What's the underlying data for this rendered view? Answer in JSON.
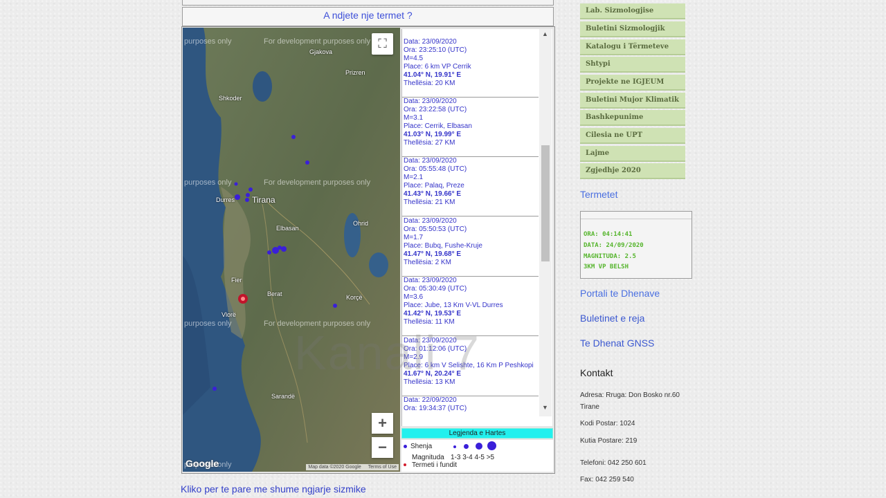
{
  "header": {
    "question": "A ndjete nje termet ?"
  },
  "map": {
    "watermark": "For development purposes only",
    "watermark_short": "purposes only",
    "cities": [
      "Shkoder",
      "Durres",
      "Tirana",
      "Elbasan",
      "Fier",
      "Berat",
      "Vlorë",
      "Korçë",
      "Ohrid",
      "Prizren",
      "Gjakova",
      "Sarandë"
    ],
    "google": "Google",
    "map_data": "Map data ©2020 Google",
    "terms": "Terms of Use",
    "fullscreen_icon": "⛶",
    "zoom_in": "+",
    "zoom_out": "−"
  },
  "quakes": [
    {
      "data": "Data: 23/09/2020",
      "ora": "Ora: 23:25:10 (UTC)",
      "m": "M=4.5",
      "place": "Place: 6 km VP Cerrik",
      "coord": "41.04° N, 19.91° E",
      "depth": "Thellësia: 20 KM"
    },
    {
      "data": "Data: 23/09/2020",
      "ora": "Ora: 23:22:58 (UTC)",
      "m": "M=3.1",
      "place": "Place: Cerrik, Elbasan",
      "coord": "41.03° N, 19.99° E",
      "depth": "Thellësia: 27 KM"
    },
    {
      "data": "Data: 23/09/2020",
      "ora": "Ora: 05:55:48 (UTC)",
      "m": "M=2.1",
      "place": "Place: Palaq, Preze",
      "coord": "41.43° N, 19.66° E",
      "depth": "Thellësia: 21 KM"
    },
    {
      "data": "Data: 23/09/2020",
      "ora": "Ora: 05:50:53 (UTC)",
      "m": "M=1.7",
      "place": "Place: Bubq, Fushe-Kruje",
      "coord": "41.47° N, 19.68° E",
      "depth": "Thellësia: 2 KM"
    },
    {
      "data": "Data: 23/09/2020",
      "ora": "Ora: 05:30:49 (UTC)",
      "m": "M=3.6",
      "place": "Place: Jube, 13 Km V-VL Durres",
      "coord": "41.42° N, 19.53° E",
      "depth": "Thellësia: 11 KM"
    },
    {
      "data": "Data: 23/09/2020",
      "ora": "Ora: 01:12:06 (UTC)",
      "m": "M=2.9",
      "place": "Place: 6 km V Selishte, 16 Km P Peshkopi",
      "coord": "41.67° N, 20.24° E",
      "depth": "Thellësia: 13 KM"
    },
    {
      "data": "Data: 22/09/2020",
      "ora": "Ora: 19:34:37 (UTC)",
      "m": "",
      "place": "",
      "coord": "",
      "depth": ""
    }
  ],
  "legend": {
    "title": "Legjenda e Hartes",
    "shenja": "Shenja",
    "magnituda": "Magnituda",
    "ranges": "1-3 3-4 4-5 >5",
    "last": "Termeti i fundit"
  },
  "more_link": "Kliko per te pare me shume ngjarje sizmike",
  "menu": [
    "Lab. Sizmologjise",
    "Buletini Sizmologjik",
    "Katalogu i Tërmeteve",
    "Shtypi",
    "Projekte ne IGJEUM",
    "Buletini Mujor Klimatik",
    "Bashkepunime",
    "Cilesia ne UPT",
    "Lajme",
    "Zgjedhje 2020"
  ],
  "sidebar": {
    "termetet": "Termetet",
    "latest": {
      "ora": "ORA: 04:14:41",
      "data": "DATA: 24/09/2020",
      "mag": "MAGNITUDA: 2.5",
      "place": "3KM VP BELSH"
    },
    "portali": "Portali te Dhenave",
    "buletinet": "Buletinet e reja",
    "gnss": "Te Dhenat GNSS",
    "kontakt": "Kontakt",
    "adresa": "Adresa: Rruga: Don Bosko nr.60",
    "city": "Tirane",
    "kodi": "Kodi Postar: 1024",
    "kutia": "Kutia Postare: 219",
    "tel": "Telefoni: 042 250 601",
    "fax": "Fax: 042 259 540"
  },
  "watermark_brand": "Kanali 7"
}
